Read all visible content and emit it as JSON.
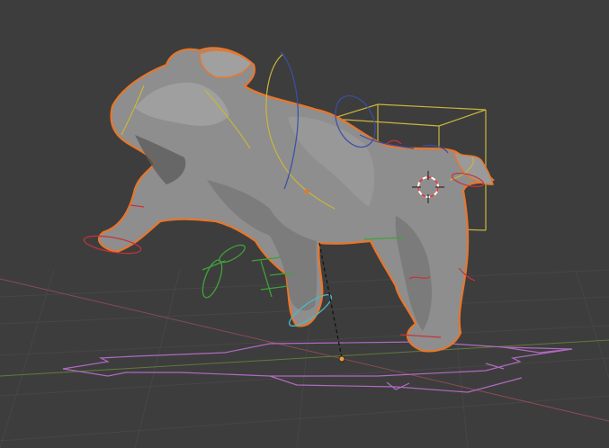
{
  "viewport": {
    "background": "#3d3d3d",
    "grid_color": "#464646",
    "x_axis_color": "#8a4a55",
    "y_axis_color": "#5f7a3a"
  },
  "mesh": {
    "fill": "#8e8e8e",
    "shade": "#6a6a6a",
    "highlight": "#b4b4b4",
    "outline": "#e8762c"
  },
  "rig": {
    "pose_yellow": "#c9b63a",
    "pose_blue": "#3a4fa6",
    "ik_green": "#3fa23b",
    "control_red": "#c8323c",
    "ground_purple": "#b06ac0",
    "cyan": "#4fb7c4"
  },
  "cursor": {
    "ring": "#d94040",
    "center": "#ffffff"
  },
  "origin_dot": "#e8a030",
  "icons": [
    "3d-cursor-icon",
    "object-origin-icon"
  ]
}
